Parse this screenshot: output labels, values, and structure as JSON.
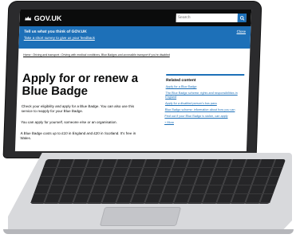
{
  "header": {
    "logo_text": "GOV.UK",
    "search_placeholder": "Search"
  },
  "banner": {
    "title": "Tell us what you think of GOV.UK",
    "link": "Take a short survey to give us your feedback",
    "close": "Close"
  },
  "breadcrumb": "Home  ›  Driving and transport  ›  Driving with medical conditions, Blue Badges and accessible transport if you're disabled",
  "main": {
    "title": "Apply for or renew a Blue Badge",
    "paragraphs": [
      "Check your eligibility and apply for a Blue Badge. You can also use this service to reapply for your Blue Badge.",
      "You can apply for yourself, someone else or an organisation.",
      "A Blue Badge costs up to £10 in England and £20 in Scotland. It's free in Wales."
    ]
  },
  "related": {
    "title": "Related content",
    "links": [
      "Apply for a Blue Badge",
      "The Blue Badge scheme: rights and responsibilities in England",
      "Apply for a disabled person's bus pass",
      "Blue Badge scheme: information about how you can",
      "Find out if your Blue Badge is stolen, can apply",
      "+ More"
    ]
  },
  "colors": {
    "header_bg": "#0b0c0c",
    "brand_blue": "#1d70b8"
  }
}
